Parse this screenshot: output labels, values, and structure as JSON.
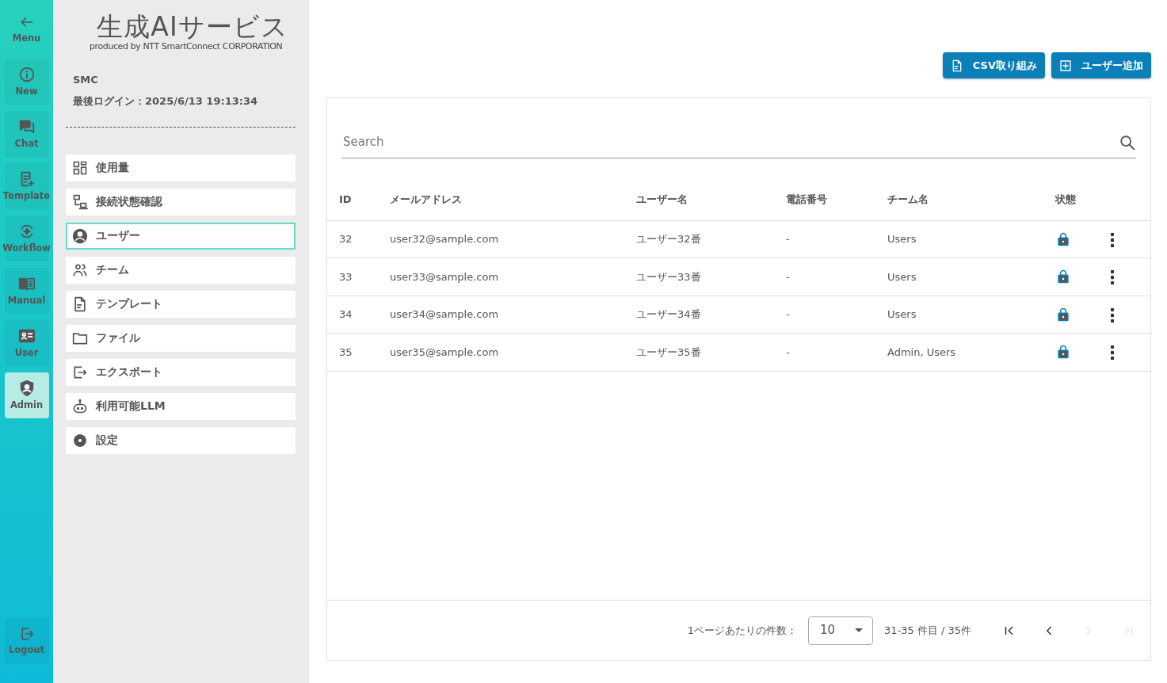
{
  "rail": {
    "back": {
      "label": "Menu"
    },
    "items": [
      {
        "label": "New",
        "selected": false
      },
      {
        "label": "Chat",
        "selected": false
      },
      {
        "label": "Template",
        "selected": false
      },
      {
        "label": "Workflow",
        "selected": false
      },
      {
        "label": "Manual",
        "selected": false
      },
      {
        "label": "User",
        "selected": false
      },
      {
        "label": "Admin",
        "selected": true
      }
    ],
    "logout": {
      "label": "Logout"
    }
  },
  "sidebar": {
    "logo_title": "生成AIサービス",
    "logo_subtitle": "produced by NTT SmartConnect CORPORATION",
    "organization": "SMC",
    "last_login": "最後ログイン：2025/6/13 19:13:34",
    "items": [
      {
        "label": "使用量",
        "selected": false
      },
      {
        "label": "接続状態確認",
        "selected": false
      },
      {
        "label": "ユーザー",
        "selected": true
      },
      {
        "label": "チーム",
        "selected": false
      },
      {
        "label": "テンプレート",
        "selected": false
      },
      {
        "label": "ファイル",
        "selected": false
      },
      {
        "label": "エクスポート",
        "selected": false
      },
      {
        "label": "利用可能LLM",
        "selected": false
      },
      {
        "label": "設定",
        "selected": false
      }
    ]
  },
  "actions": [
    "CSV取り組み",
    "ユーザー追加"
  ],
  "search": {
    "placeholder": "Search"
  },
  "table": {
    "columns": [
      "ID",
      "メールアドレス",
      "ユーザー名",
      "電話番号",
      "チーム名",
      "状態"
    ],
    "rows": [
      [
        "32",
        "user32@sample.com",
        "ユーザー32番",
        "-",
        "Users"
      ],
      [
        "33",
        "user33@sample.com",
        "ユーザー33番",
        "-",
        "Users"
      ],
      [
        "34",
        "user34@sample.com",
        "ユーザー34番",
        "-",
        "Users"
      ],
      [
        "35",
        "user35@sample.com",
        "ユーザー35番",
        "-",
        "Admin, Users"
      ]
    ]
  },
  "pagination": {
    "per_page_label": "1ページあたりの件数：",
    "per_page": "10",
    "range": "31-35 件目 / 35件",
    "buttons": [
      {
        "disabled": false
      },
      {
        "disabled": false
      },
      {
        "disabled": true
      },
      {
        "disabled": true
      }
    ]
  }
}
